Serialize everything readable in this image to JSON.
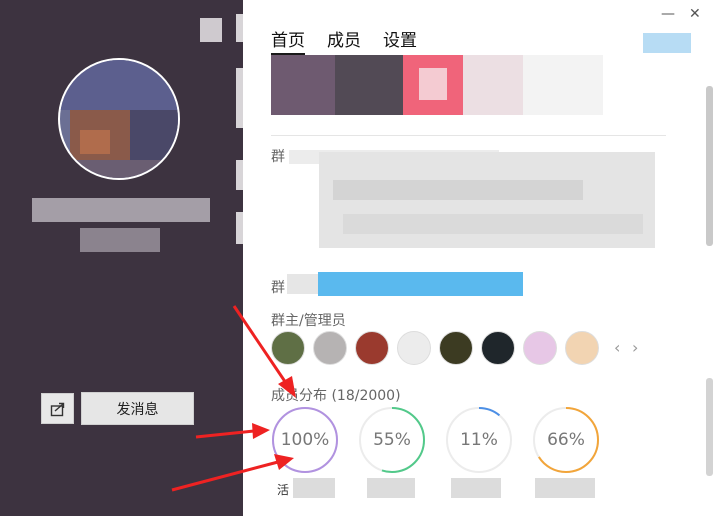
{
  "window": {
    "minimize_glyph": "—",
    "close_glyph": "✕"
  },
  "tabs": [
    {
      "label": "首页",
      "active": true
    },
    {
      "label": "成员",
      "active": false
    },
    {
      "label": "设置",
      "active": false
    }
  ],
  "left_panel": {
    "send_message_label": "发消息",
    "share_icon": "share-icon"
  },
  "group_info": {
    "group_prefix_1": "群",
    "group_prefix_2": "群",
    "admins_label": "群主/管理员",
    "admin_count": 8
  },
  "distribution": {
    "label": "成员分布 (18/2000)",
    "rings": [
      {
        "percent": 100,
        "text": "100%",
        "color": "#b192e0",
        "caption": "活"
      },
      {
        "percent": 55,
        "text": "55%",
        "color": "#52c98a",
        "caption": ""
      },
      {
        "percent": 11,
        "text": "11%",
        "color": "#4c8fe6",
        "caption": ""
      },
      {
        "percent": 66,
        "text": "66%",
        "color": "#f2a53a",
        "caption": ""
      }
    ]
  },
  "colors": {
    "left_bg": "#3d3340",
    "accent_blue": "#5ab9ee",
    "arrow_red": "#ee2222"
  }
}
